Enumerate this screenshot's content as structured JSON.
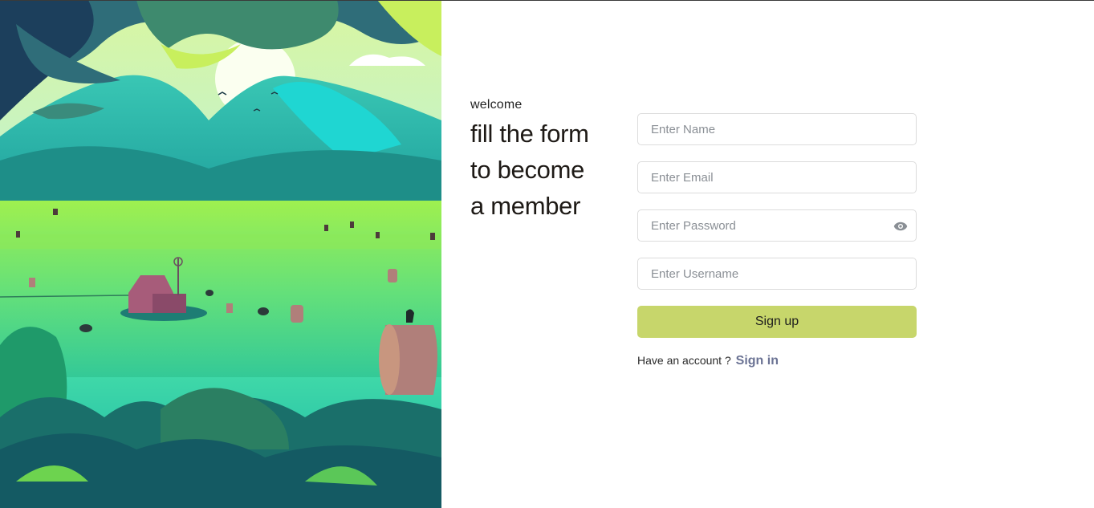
{
  "intro": {
    "welcome": "welcome",
    "headline_line1": "fill the form",
    "headline_line2": "to become",
    "headline_line3": "a member"
  },
  "form": {
    "name_placeholder": "Enter Name",
    "email_placeholder": "Enter Email",
    "password_placeholder": "Enter Password",
    "username_placeholder": "Enter Username",
    "password_toggle_icon": "eye-icon",
    "submit_label": "Sign up",
    "account_prompt": "Have an account ?",
    "signin_label": "Sign in"
  },
  "colors": {
    "button": "#c7d66b",
    "signin_link": "#6b7394",
    "heading": "#1e1a16"
  }
}
